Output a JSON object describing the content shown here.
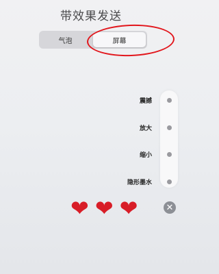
{
  "header": {
    "title": "带效果发送"
  },
  "tabs": [
    {
      "label": "气泡",
      "active": false
    },
    {
      "label": "屏幕",
      "active": true
    }
  ],
  "effects": [
    {
      "label": "震撼"
    },
    {
      "label": "放大"
    },
    {
      "label": "缩小"
    },
    {
      "label": "隐形墨水"
    }
  ],
  "preview": {
    "glyph": "❤"
  },
  "close": {
    "glyph": "✕"
  },
  "colors": {
    "annotation": "#e2161c",
    "heart": "#d81d27"
  }
}
